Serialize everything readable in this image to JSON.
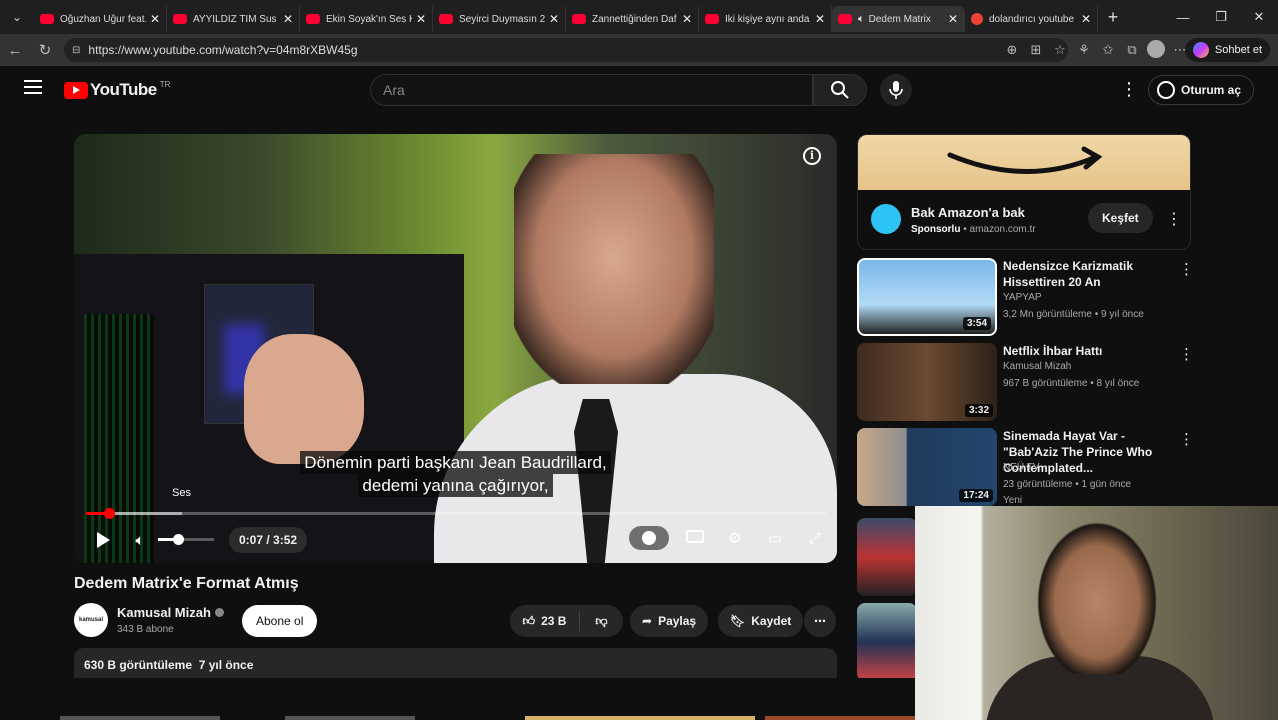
{
  "browser": {
    "tabs": [
      {
        "title": "Oğuzhan Uğur feat.",
        "active": false,
        "favicon": "youtube-icon"
      },
      {
        "title": "AYYILDIZ TİM Sus S",
        "active": false,
        "favicon": "youtube-icon"
      },
      {
        "title": "Ekin Soyak'ın Ses K",
        "active": false,
        "favicon": "youtube-icon"
      },
      {
        "title": "Seyirci Duymasın 2(",
        "active": false,
        "favicon": "youtube-icon"
      },
      {
        "title": "Zannettiğinden Daf",
        "active": false,
        "favicon": "youtube-icon"
      },
      {
        "title": "İki kişiye aynı anda",
        "active": false,
        "favicon": "youtube-icon"
      },
      {
        "title": "Dedem Matrix",
        "active": true,
        "favicon": "youtube-icon"
      },
      {
        "title": "dolandırıcı youtube",
        "active": false,
        "favicon": "google-icon"
      }
    ],
    "url": "https://www.youtube.com/watch?v=04m8rXBW45g",
    "copilot_label": "Sohbet et"
  },
  "youtube": {
    "logo_text": "YouTube",
    "region": "TR",
    "search_placeholder": "Ara",
    "signin_label": "Oturum aç"
  },
  "player": {
    "subtitle_line1": "Dönemin parti başkanı Jean Baudrillard,",
    "subtitle_line2": "dedemi yanına çağırıyor,",
    "tooltip": "Ses",
    "time": "0:07 / 3:52",
    "played_fraction": 0.031,
    "loaded_fraction": 0.13,
    "volume_fraction": 0.35
  },
  "video": {
    "title": "Dedem Matrix'e Format Atmış",
    "channel": "Kamusal Mizah",
    "channel_avatar_text": "kamusal",
    "subscribers": "343 B abone",
    "subscribe_label": "Abone ol",
    "likes": "23 B",
    "share_label": "Paylaş",
    "save_label": "Kaydet",
    "views_date": "630 B görüntüleme  7 yıl önce"
  },
  "ad": {
    "title": "Bak Amazon'a bak",
    "sponsored": "Sponsorlu",
    "domain": "amazon.com.tr",
    "cta": "Keşfet"
  },
  "recommendations": [
    {
      "title": "Nedensizce Karizmatik Hissettiren 20 An",
      "channel": "YAPYAP",
      "meta": "3,2 Mn görüntüleme • 9 yıl önce",
      "duration": "3:54"
    },
    {
      "title": "Netflix İhbar Hattı",
      "channel": "Kamusal Mizah",
      "meta": "967 B görüntüleme • 8 yıl önce",
      "duration": "3:32"
    },
    {
      "title": "Sinemada Hayat Var - \"Bab'Aziz The Prince Who Contemplated...",
      "channel": "NEÜ TV",
      "meta": "23 görüntüleme • 1 gün önce",
      "badge": "Yeni",
      "duration": "17:24"
    }
  ],
  "colors": {
    "accent": "#ff0000",
    "background": "#0f0f0f",
    "surface": "#272727"
  }
}
